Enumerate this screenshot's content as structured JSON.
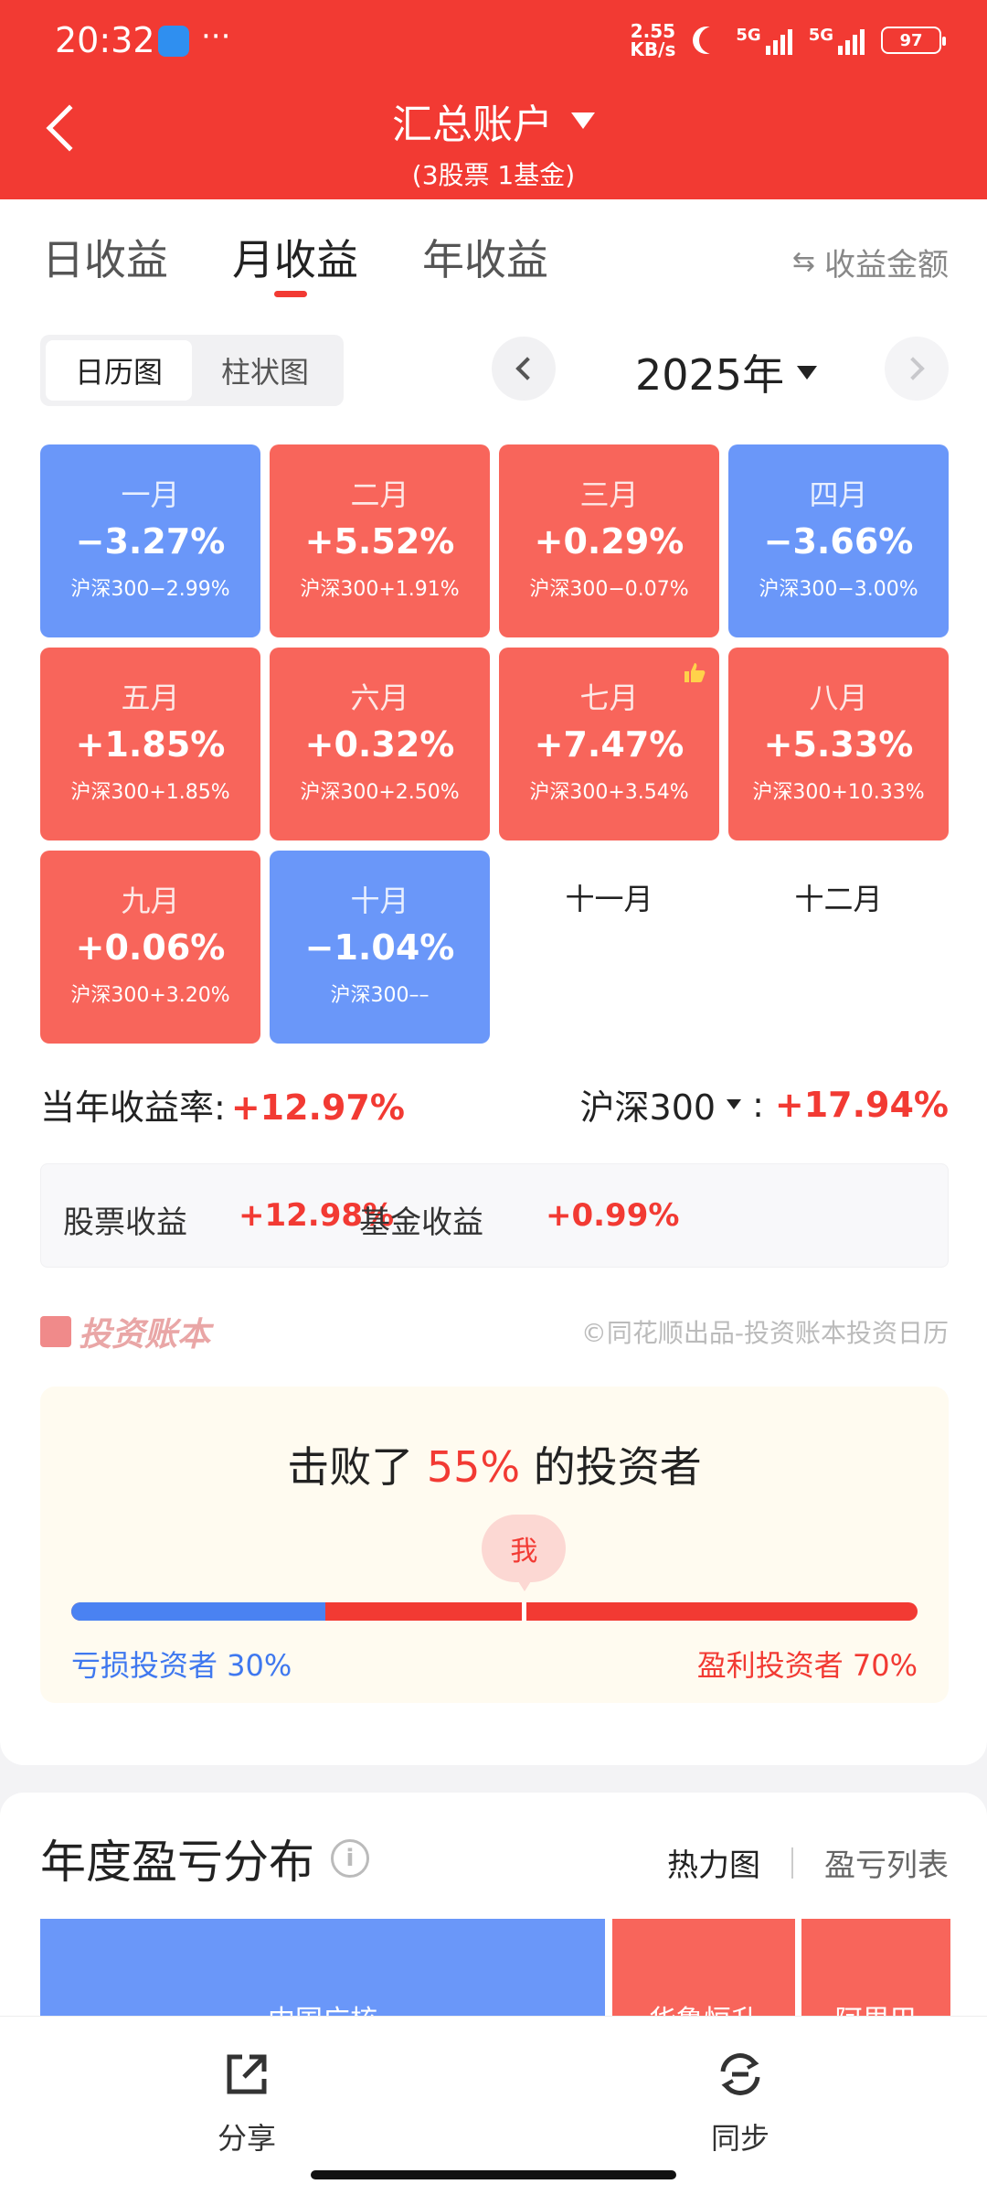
{
  "status": {
    "time": "20:32",
    "dots": "···",
    "net_speed_value": "2.55",
    "net_speed_unit": "KB/s",
    "sig1_label": "5G",
    "sig2_label": "5G",
    "battery": "97"
  },
  "header": {
    "title": "汇总账户",
    "subtitle": "(3股票 1基金)"
  },
  "tabs": [
    {
      "label": "日收益"
    },
    {
      "label": "月收益"
    },
    {
      "label": "年收益"
    }
  ],
  "active_tab": "月收益",
  "amount_toggle": "收益金额",
  "view_toggle": {
    "calendar": "日历图",
    "bar": "柱状图",
    "active": "日历图"
  },
  "year": "2025年",
  "months": [
    {
      "name": "一月",
      "pct": "−3.27%",
      "bench": "沪深300−2.99%",
      "tone": "blue"
    },
    {
      "name": "二月",
      "pct": "+5.52%",
      "bench": "沪深300+1.91%",
      "tone": "red"
    },
    {
      "name": "三月",
      "pct": "+0.29%",
      "bench": "沪深300−0.07%",
      "tone": "red"
    },
    {
      "name": "四月",
      "pct": "−3.66%",
      "bench": "沪深300−3.00%",
      "tone": "blue"
    },
    {
      "name": "五月",
      "pct": "+1.85%",
      "bench": "沪深300+1.85%",
      "tone": "red"
    },
    {
      "name": "六月",
      "pct": "+0.32%",
      "bench": "沪深300+2.50%",
      "tone": "red"
    },
    {
      "name": "七月",
      "pct": "+7.47%",
      "bench": "沪深300+3.54%",
      "tone": "red",
      "icon": "thumbs-up-icon"
    },
    {
      "name": "八月",
      "pct": "+5.33%",
      "bench": "沪深300+10.33%",
      "tone": "red"
    },
    {
      "name": "九月",
      "pct": "+0.06%",
      "bench": "沪深300+3.20%",
      "tone": "red"
    },
    {
      "name": "十月",
      "pct": "−1.04%",
      "bench": "沪深300––",
      "tone": "blue"
    },
    {
      "name": "十一月",
      "tone": "empty"
    },
    {
      "name": "十二月",
      "tone": "empty"
    }
  ],
  "summary": {
    "year_return_label": "当年收益率:",
    "year_return_value": "+12.97%",
    "bench_label": "沪深300",
    "bench_colon": ":",
    "bench_value": "+17.94%"
  },
  "split": {
    "stock_label": "股票收益",
    "stock_value": "+12.98%",
    "fund_label": "基金收益",
    "fund_value": "+0.99%"
  },
  "brand": {
    "name": "投资账本",
    "credit": "©同花顺出品-投资账本投资日历"
  },
  "beat": {
    "prefix": "击败了",
    "pct": "55%",
    "suffix": "的投资者",
    "me": "我",
    "loss_label": "亏损投资者 30%",
    "profit_label": "盈利投资者 70%",
    "loss_fraction": 0.3,
    "me_fraction": 0.535
  },
  "distribution": {
    "title": "年度盈亏分布",
    "heatmap_link": "热力图",
    "list_link": "盈亏列表",
    "tiles": [
      {
        "label": "中国广核",
        "tone": "blue"
      },
      {
        "label": "华鲁恒升",
        "tone": "red"
      },
      {
        "label": "阿里巴",
        "tone": "red"
      }
    ]
  },
  "bottom": {
    "share": "分享",
    "sync": "同步"
  },
  "colors": {
    "brand_red": "#f23a33",
    "gain_tile": "#f8655b",
    "loss_tile": "#6a97f9",
    "loss_bar": "#4a82f2"
  }
}
